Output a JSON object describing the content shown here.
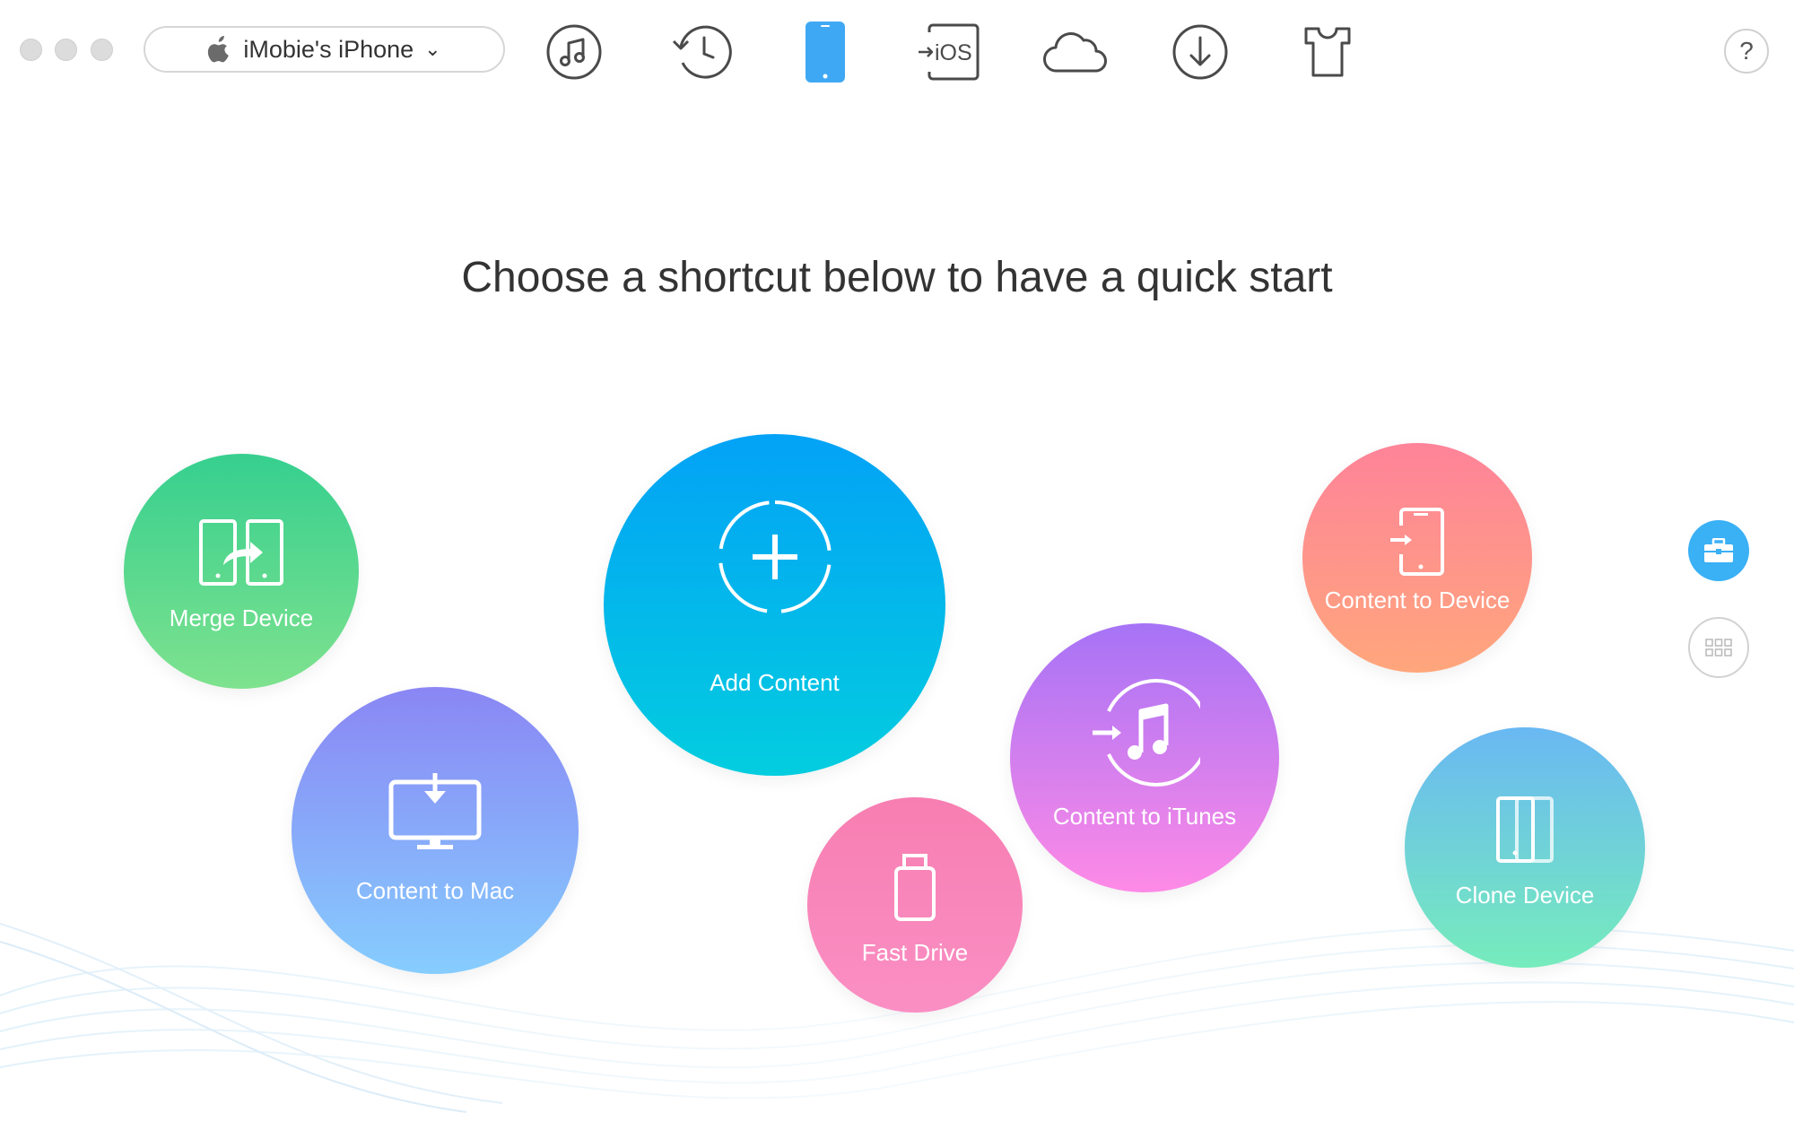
{
  "window": {
    "traffic_lights": [
      "close",
      "minimize",
      "zoom"
    ]
  },
  "toolbar": {
    "device_name": "iMobie's iPhone",
    "device_logo": "apple-icon",
    "chevron": "⌄",
    "tools": [
      {
        "name": "music-icon",
        "label": ""
      },
      {
        "name": "history-icon",
        "label": ""
      },
      {
        "name": "device-icon",
        "label": "",
        "active": true
      },
      {
        "name": "ios-mover-icon",
        "label": "iOS"
      },
      {
        "name": "icloud-icon",
        "label": ""
      },
      {
        "name": "download-icon",
        "label": ""
      },
      {
        "name": "skin-icon",
        "label": ""
      }
    ],
    "help_label": "?"
  },
  "main": {
    "headline": "Choose a shortcut below to have a quick start",
    "shortcuts": [
      {
        "id": "merge",
        "label": "Merge Device",
        "icon": "merge-device-icon"
      },
      {
        "id": "mac",
        "label": "Content to Mac",
        "icon": "content-to-mac-icon"
      },
      {
        "id": "add",
        "label": "Add Content",
        "icon": "add-content-icon"
      },
      {
        "id": "fast",
        "label": "Fast Drive",
        "icon": "fast-drive-icon"
      },
      {
        "id": "itunes",
        "label": "Content to iTunes",
        "icon": "content-to-itunes-icon"
      },
      {
        "id": "device",
        "label": "Content to Device",
        "icon": "content-to-device-icon"
      },
      {
        "id": "clone",
        "label": "Clone Device",
        "icon": "clone-device-icon"
      }
    ]
  },
  "side_controls": {
    "shortcuts_view": "toolbox-icon",
    "grid_view": "grid-icon"
  },
  "colors": {
    "accent": "#3ab0f5",
    "merge": [
      "#36cf8f",
      "#7ee28e"
    ],
    "mac": [
      "#8a86f4",
      "#86cdfe"
    ],
    "add": [
      "#03a2f6",
      "#03cddf"
    ],
    "fast": [
      "#f77eb1",
      "#fa8fc4"
    ],
    "itunes": [
      "#a673f6",
      "#fe8ae6"
    ],
    "device": [
      "#fe8399",
      "#ffa67c"
    ],
    "clone": [
      "#69b8f3",
      "#76ecbc"
    ]
  }
}
